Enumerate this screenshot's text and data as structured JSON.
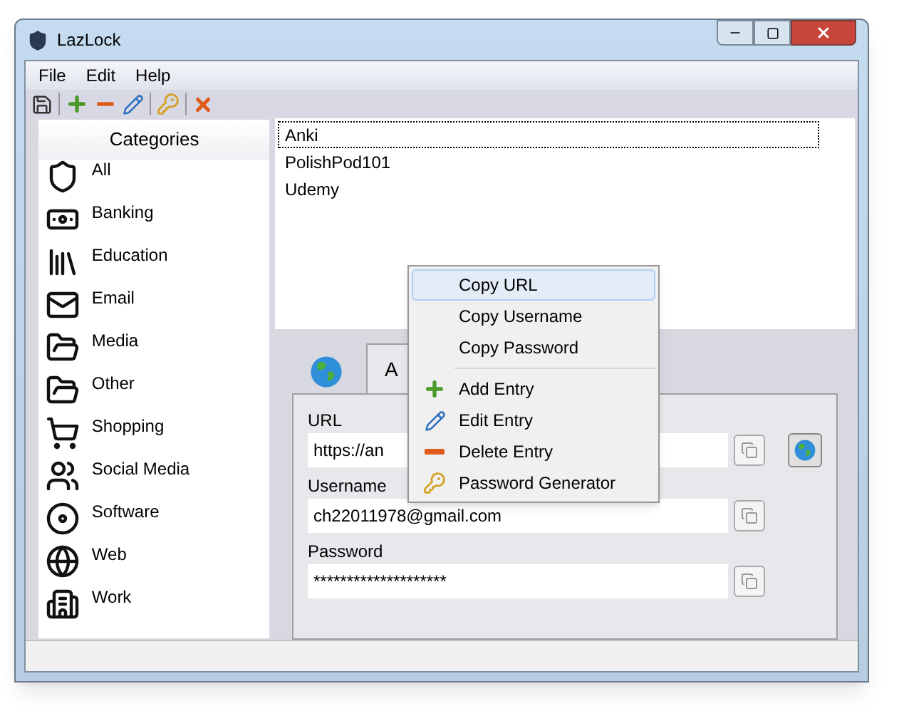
{
  "window": {
    "title": "LazLock"
  },
  "menu_bar": [
    "File",
    "Edit",
    "Help"
  ],
  "categories": {
    "title": "Categories",
    "items": [
      {
        "label": "All"
      },
      {
        "label": "Banking"
      },
      {
        "label": "Education"
      },
      {
        "label": "Email"
      },
      {
        "label": "Media"
      },
      {
        "label": "Other"
      },
      {
        "label": "Shopping"
      },
      {
        "label": "Social Media"
      },
      {
        "label": "Software"
      },
      {
        "label": "Web"
      },
      {
        "label": "Work"
      }
    ]
  },
  "entries": [
    {
      "label": "Anki",
      "selected": true
    },
    {
      "label": "PolishPod101",
      "selected": false
    },
    {
      "label": "Udemy",
      "selected": false
    }
  ],
  "tabs": [
    {
      "kind": "icon",
      "selected": false
    },
    {
      "kind": "text",
      "label": "A",
      "selected": true
    }
  ],
  "fields": [
    {
      "label": "URL",
      "value": "https://an",
      "browse": true
    },
    {
      "label": "Username",
      "value": "ch22011978@gmail.com",
      "browse": false
    },
    {
      "label": "Password",
      "value": "********************",
      "browse": false
    }
  ],
  "context_menu": [
    {
      "kind": "item",
      "label": "Copy URL",
      "selected": true
    },
    {
      "kind": "item",
      "label": "Copy Username",
      "selected": false
    },
    {
      "kind": "item",
      "label": "Copy Password",
      "selected": false
    },
    {
      "kind": "separator"
    },
    {
      "kind": "add",
      "label": "Add Entry",
      "selected": false
    },
    {
      "kind": "edit",
      "label": "Edit Entry",
      "selected": false
    },
    {
      "kind": "delete",
      "label": "Delete Entry",
      "selected": false
    },
    {
      "kind": "key",
      "label": "Password Generator",
      "selected": false
    }
  ]
}
